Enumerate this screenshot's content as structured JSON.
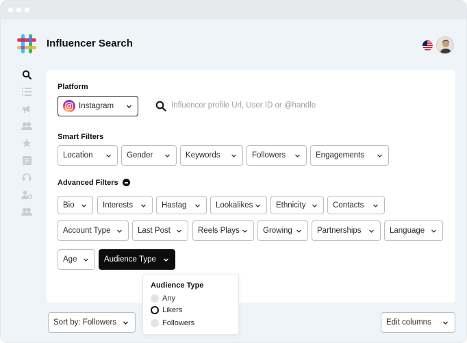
{
  "header": {
    "title": "Influencer Search",
    "flag_icon": "us-flag-icon",
    "avatar_icon": "user-avatar"
  },
  "sidebar": {
    "items": [
      {
        "name": "search-icon",
        "active": true
      },
      {
        "name": "list-icon",
        "active": false
      },
      {
        "name": "megaphone-icon",
        "active": false
      },
      {
        "name": "users-icon",
        "active": false
      },
      {
        "name": "star-icon",
        "active": false
      },
      {
        "name": "tag-icon",
        "active": false
      },
      {
        "name": "headset-icon",
        "active": false
      },
      {
        "name": "user-settings-icon",
        "active": false
      },
      {
        "name": "team-icon",
        "active": false
      }
    ]
  },
  "platform": {
    "label": "Platform",
    "selected": "Instagram"
  },
  "search": {
    "placeholder": "Influencer profile Url, User ID or @handle"
  },
  "smart_filters": {
    "label": "Smart Filters",
    "items": [
      "Location",
      "Gender",
      "Keywords",
      "Followers",
      "Engagements"
    ]
  },
  "advanced_filters": {
    "label": "Advanced Filters",
    "row1": [
      "Bio",
      "Interests",
      "Hastag",
      "Lookalikes",
      "Ethnicity",
      "Contacts"
    ],
    "row2": [
      "Account Type",
      "Last Post",
      "Reels Plays",
      "Growing",
      "Partnerships",
      "Language"
    ],
    "row3": [
      "Age",
      "Audience Type"
    ]
  },
  "audience_popover": {
    "title": "Audience Type",
    "options": [
      "Any",
      "Likers",
      "Followers"
    ],
    "selected": "Likers"
  },
  "bottom": {
    "sort_label": "Sort by: Followers",
    "edit_columns_label": "Edit columns"
  },
  "colors": {
    "background": "#eef4f8",
    "card": "#ffffff",
    "active_filter": "#0d0d0d",
    "border": "#b9bdc1"
  }
}
